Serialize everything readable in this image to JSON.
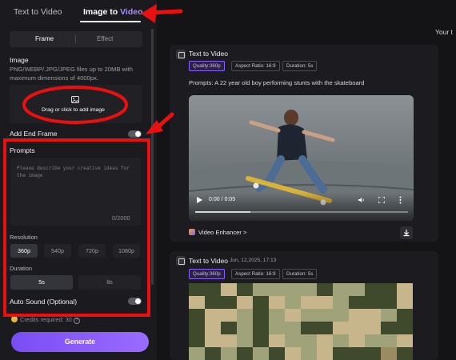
{
  "tabs": {
    "text_to_video": "Text to Video",
    "image_to_video_prefix": "Image to",
    "image_to_video_accent": "Video"
  },
  "subtabs": {
    "frame": "Frame",
    "effect": "Effect"
  },
  "image_section": {
    "title": "Image",
    "hint": "PNG/WEBP/.JPG/JPEG files up to 20MB with maximum dimensions of 4000px.",
    "drop_text": "Drag or click to add image",
    "icon": "image-icon"
  },
  "end_frame": {
    "label": "Add End Frame",
    "enabled": false
  },
  "prompts": {
    "label": "Prompts",
    "placeholder": "Please describe your creative ideas for the image",
    "counter": "0/2000"
  },
  "resolution": {
    "label": "Resolution",
    "options": [
      "360p",
      "540p",
      "720p",
      "1080p"
    ],
    "selected": "360p"
  },
  "duration": {
    "label": "Duration",
    "options": [
      "5s",
      "8s"
    ],
    "selected": "5s"
  },
  "auto_sound": {
    "label": "Auto Sound (Optional)",
    "enabled": false
  },
  "credits": {
    "text": "Credits required: 30"
  },
  "generate": {
    "label": "Generate"
  },
  "right_header": {
    "text": "Your t"
  },
  "cards": [
    {
      "title": "Text to Video",
      "date": "",
      "chips": [
        "Quality:360p",
        "Aspect Ratio: 16:9",
        "Duration: 5s"
      ],
      "prompt": "Prompts:  A 22 year old boy performing stunts with the skateboard",
      "video": {
        "time": "0:00 / 0:05",
        "progress": 0.26
      },
      "enhancer": "Video Enhancer >"
    },
    {
      "title": "Text to Video",
      "date": "Jun, 12,2025, 17:13",
      "chips": [
        "Quality:360p",
        "Aspect Ratio: 16:9",
        "Duration: 5s"
      ]
    }
  ],
  "colors": {
    "accent": "#8a63ff",
    "annotation": "#e81010",
    "background": "#141416",
    "panel": "#1b1b1f"
  }
}
